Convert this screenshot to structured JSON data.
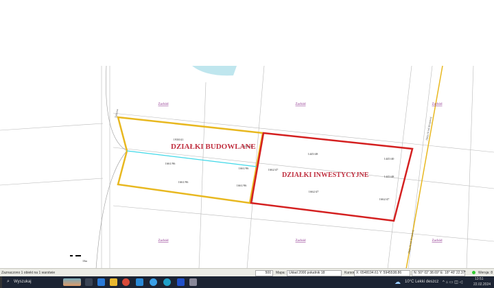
{
  "map": {
    "labels_zachod": [
      "Zachód",
      "Zachód",
      "Zachód",
      "Zachód",
      "Zachód",
      "Zachód"
    ],
    "title_budowlane": "DZIAŁKI BUDOWLANE",
    "title_inwestycyjne": "DZIAŁKI INWESTYCYJNE",
    "street_left": "Żelazna",
    "street_right": "Aleja Armii Krajowej",
    "parcels": [
      "1938/41",
      "1661/96",
      "1661/96",
      "1661/96",
      "1661/96",
      "1938/41",
      "1445/48",
      "1445/40",
      "1445/48",
      "1662/47",
      "1662/47",
      "1662/47"
    ],
    "scale_label": "10m",
    "colors": {
      "budowlane": "#e8b820",
      "inwestycyjne": "#d42020",
      "divider": "#40d8e8",
      "label": "#c03040"
    }
  },
  "statusbar": {
    "selection": "Zaznaczono 1 obiekt na 1 warstwie",
    "scale": "500",
    "map_label": "Mapa:",
    "crs": "Układ 2000 południk 18",
    "cursor_label": "Kursor:",
    "x": "X: 6548194.61",
    "y": "Y: 5945538.86",
    "geo": "N: 50° 02' 38.69\"  E: 18° 40' 22.37\"",
    "version": "Wersja: 8"
  },
  "taskbar": {
    "search": "Wyszukaj",
    "weather": "10°C  Lekki deszcz",
    "time": "13:51",
    "date": "22.02.2024"
  }
}
